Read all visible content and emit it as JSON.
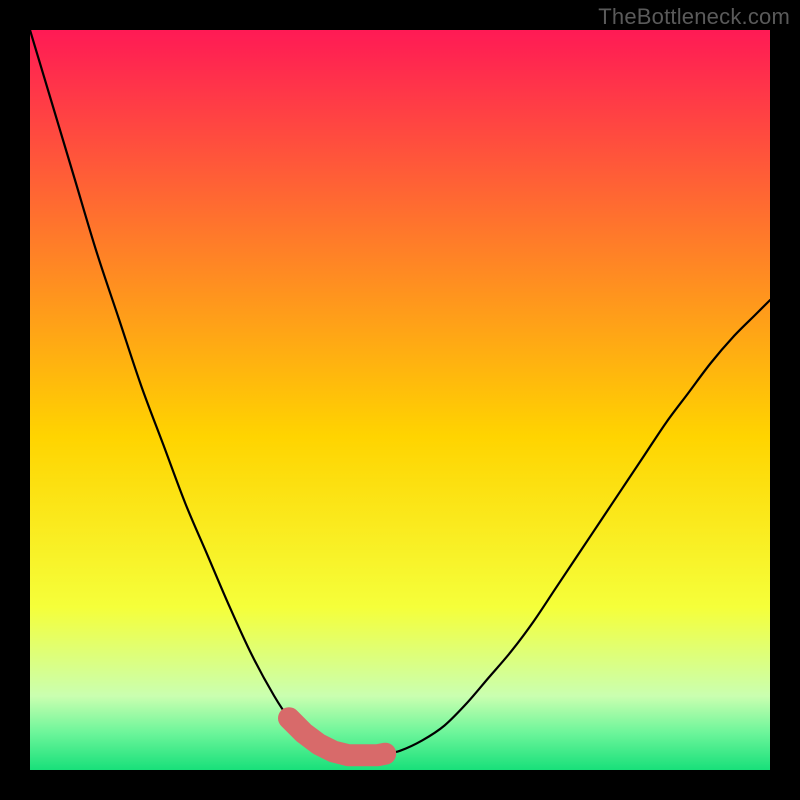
{
  "watermark": "TheBottleneck.com",
  "colors": {
    "bg_black": "#000000",
    "grad_top": "#ff1a55",
    "grad_mid1": "#ff7a2a",
    "grad_mid2": "#ffd400",
    "grad_mid3": "#f5ff3a",
    "grad_low1": "#caffb0",
    "grad_low2": "#6cf59a",
    "grad_bottom": "#18e07a",
    "curve": "#000000",
    "marker": "#d86a6a",
    "marker_stroke": "#c05858"
  },
  "chart_data": {
    "type": "line",
    "title": "",
    "xlabel": "",
    "ylabel": "",
    "xlim": [
      0,
      100
    ],
    "ylim": [
      0,
      100
    ],
    "grid": false,
    "legend": false,
    "annotations": [],
    "series": [
      {
        "name": "curve",
        "x": [
          0,
          3,
          6,
          9,
          12,
          15,
          18,
          21,
          24,
          27,
          30,
          33,
          35,
          37,
          39,
          41,
          43,
          45,
          46,
          47,
          48,
          50,
          53,
          56,
          59,
          62,
          65,
          68,
          71,
          74,
          77,
          80,
          83,
          86,
          89,
          92,
          95,
          98,
          100
        ],
        "y": [
          100,
          90,
          80,
          70,
          61,
          52,
          44,
          36,
          29,
          22,
          15.5,
          10,
          7,
          5,
          3.5,
          2.5,
          2,
          2,
          2,
          2,
          2.2,
          2.6,
          4,
          6,
          9,
          12.5,
          16,
          20,
          24.5,
          29,
          33.5,
          38,
          42.5,
          47,
          51,
          55,
          58.5,
          61.5,
          63.5
        ]
      }
    ],
    "markers": {
      "name": "highlighted-range",
      "x_range": [
        35,
        48
      ],
      "y_approx": 2,
      "style": "thick-rounded",
      "color": "#d86a6a"
    },
    "gradient_stops": [
      {
        "pos": 0.0,
        "color": "#ff1a55"
      },
      {
        "pos": 0.28,
        "color": "#ff7a2a"
      },
      {
        "pos": 0.55,
        "color": "#ffd400"
      },
      {
        "pos": 0.78,
        "color": "#f5ff3a"
      },
      {
        "pos": 0.9,
        "color": "#caffb0"
      },
      {
        "pos": 0.95,
        "color": "#6cf59a"
      },
      {
        "pos": 1.0,
        "color": "#18e07a"
      }
    ]
  }
}
